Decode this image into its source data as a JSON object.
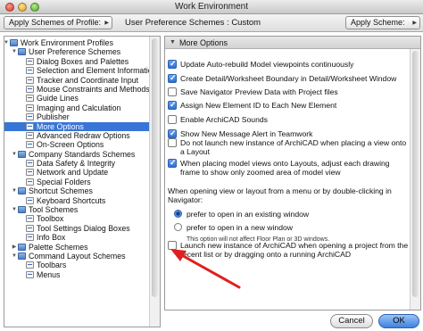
{
  "window": {
    "title": "Work Environment"
  },
  "toolbar": {
    "profile_popup": "Apply Schemes of Profile:",
    "current_scheme": "User Preference Schemes : Custom",
    "apply_popup": "Apply Scheme:"
  },
  "tree": {
    "items": [
      {
        "label": "Work Environment Profiles",
        "level": 0,
        "type": "folder",
        "open": true
      },
      {
        "label": "User Preference Schemes",
        "level": 1,
        "type": "folder",
        "open": true
      },
      {
        "label": "Dialog Boxes and Palettes",
        "level": 2,
        "type": "page"
      },
      {
        "label": "Selection and Element Information",
        "level": 2,
        "type": "page"
      },
      {
        "label": "Tracker and Coordinate Input",
        "level": 2,
        "type": "page"
      },
      {
        "label": "Mouse Constraints and Methods",
        "level": 2,
        "type": "page"
      },
      {
        "label": "Guide Lines",
        "level": 2,
        "type": "page"
      },
      {
        "label": "Imaging and Calculation",
        "level": 2,
        "type": "page"
      },
      {
        "label": "Publisher",
        "level": 2,
        "type": "page"
      },
      {
        "label": "More Options",
        "level": 2,
        "type": "page",
        "selected": true
      },
      {
        "label": "Advanced Redraw Options",
        "level": 2,
        "type": "page"
      },
      {
        "label": "On-Screen Options",
        "level": 2,
        "type": "page"
      },
      {
        "label": "Company Standards Schemes",
        "level": 1,
        "type": "folder",
        "open": true
      },
      {
        "label": "Data Safety & Integrity",
        "level": 2,
        "type": "page"
      },
      {
        "label": "Network and Update",
        "level": 2,
        "type": "page"
      },
      {
        "label": "Special Folders",
        "level": 2,
        "type": "page"
      },
      {
        "label": "Shortcut Schemes",
        "level": 1,
        "type": "folder",
        "open": true
      },
      {
        "label": "Keyboard Shortcuts",
        "level": 2,
        "type": "page"
      },
      {
        "label": "Tool Schemes",
        "level": 1,
        "type": "folder",
        "open": true
      },
      {
        "label": "Toolbox",
        "level": 2,
        "type": "page"
      },
      {
        "label": "Tool Settings Dialog Boxes",
        "level": 2,
        "type": "page"
      },
      {
        "label": "Info Box",
        "level": 2,
        "type": "page"
      },
      {
        "label": "Palette Schemes",
        "level": 1,
        "type": "folder",
        "open": false
      },
      {
        "label": "Command Layout Schemes",
        "level": 1,
        "type": "folder",
        "open": true
      },
      {
        "label": "Toolbars",
        "level": 2,
        "type": "page"
      },
      {
        "label": "Menus",
        "level": 2,
        "type": "page"
      }
    ]
  },
  "panel": {
    "title": "More Options",
    "options": [
      {
        "label": "Update Auto-rebuild Model viewpoints continuously",
        "checked": true
      },
      {
        "label": "Create Detail/Worksheet Boundary in Detail/Worksheet Window",
        "checked": true
      },
      {
        "label": "Save Navigator Preview Data with Project files",
        "checked": false
      },
      {
        "label": "Assign New Element ID to Each New Element",
        "checked": true
      },
      {
        "label": "Enable ArchiCAD Sounds",
        "checked": false
      },
      {
        "label": "Show New Message Alert in Teamwork",
        "checked": true
      },
      {
        "label": "Do not launch new instance of ArchiCAD when placing a view onto a Layout",
        "checked": false
      },
      {
        "label": "When placing model views onto Layouts, adjust each drawing frame to show only zoomed area of model view",
        "checked": true
      }
    ],
    "navigator_text": "When opening view or layout from a menu or by double-clicking in Navigator:",
    "radios": [
      {
        "label": "prefer to open in an existing window",
        "selected": true
      },
      {
        "label": "prefer to open in a new window",
        "selected": false
      }
    ],
    "note": "This option will not affect Floor Plan or 3D windows.",
    "launch_option": {
      "label": "Launch new instance of ArchiCAD when opening a project from the recent list or by dragging onto a running ArchiCAD",
      "checked": false
    }
  },
  "buttons": {
    "cancel": "Cancel",
    "ok": "OK"
  },
  "colors": {
    "selection": "#3875d7",
    "annotation_arrow": "#e02020",
    "default_button": "#3d82e0"
  }
}
